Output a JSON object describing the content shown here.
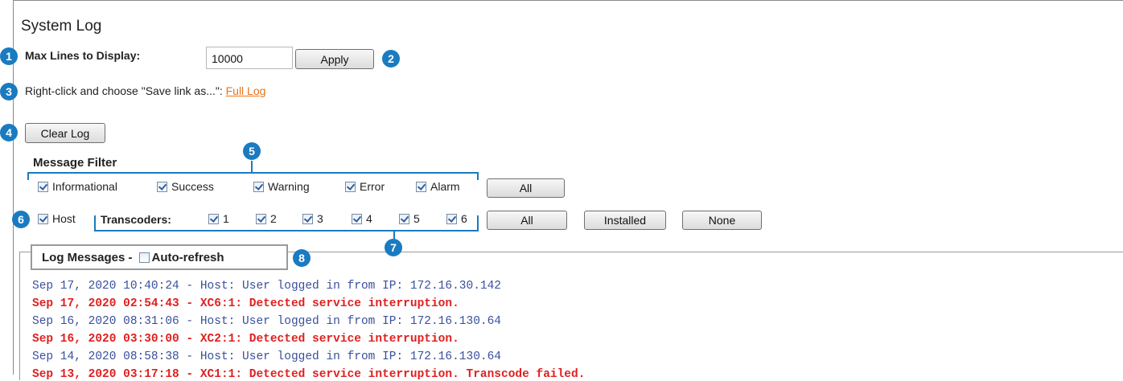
{
  "title": "System Log",
  "max_lines": {
    "label": "Max Lines to Display:",
    "value": "10000",
    "apply_label": "Apply"
  },
  "save_link": {
    "prefix": "Right-click and choose \"Save link as...\":",
    "link_label": "Full Log"
  },
  "clear_log_label": "Clear Log",
  "message_filter": {
    "heading": "Message Filter",
    "items": [
      {
        "label": "Informational",
        "checked": true
      },
      {
        "label": "Success",
        "checked": true
      },
      {
        "label": "Warning",
        "checked": true
      },
      {
        "label": "Error",
        "checked": true
      },
      {
        "label": "Alarm",
        "checked": true
      }
    ],
    "all_label": "All"
  },
  "sources": {
    "host_label": "Host",
    "transcoders_label": "Transcoders:",
    "transcoders": [
      "1",
      "2",
      "3",
      "4",
      "5",
      "6"
    ],
    "all_label": "All",
    "installed_label": "Installed",
    "none_label": "None"
  },
  "log": {
    "title": "Log Messages -",
    "auto_refresh_label": "Auto-refresh",
    "auto_refresh_checked": false,
    "lines": [
      {
        "text": "Sep 17, 2020 10:40:24 - Host: User logged in from IP: 172.16.30.142",
        "level": "info"
      },
      {
        "text": "Sep 17, 2020 02:54:43 -  XC6:1: Detected service interruption.",
        "level": "error"
      },
      {
        "text": "Sep 16, 2020 08:31:06 - Host: User logged in from IP: 172.16.130.64",
        "level": "info"
      },
      {
        "text": "Sep 16, 2020 03:30:00 -  XC2:1: Detected service interruption.",
        "level": "error"
      },
      {
        "text": "Sep 14, 2020 08:58:38 - Host: User logged in from IP: 172.16.130.64",
        "level": "info"
      },
      {
        "text": "Sep 13, 2020 03:17:18 -  XC1:1: Detected service interruption. Transcode failed.",
        "level": "error"
      }
    ]
  },
  "callouts": [
    "1",
    "2",
    "3",
    "4",
    "5",
    "6",
    "7",
    "8"
  ],
  "colors": {
    "callout": "#1a7bc0",
    "link": "#e8741a",
    "info_text": "#3a4f9c",
    "error_text": "#e02020"
  }
}
